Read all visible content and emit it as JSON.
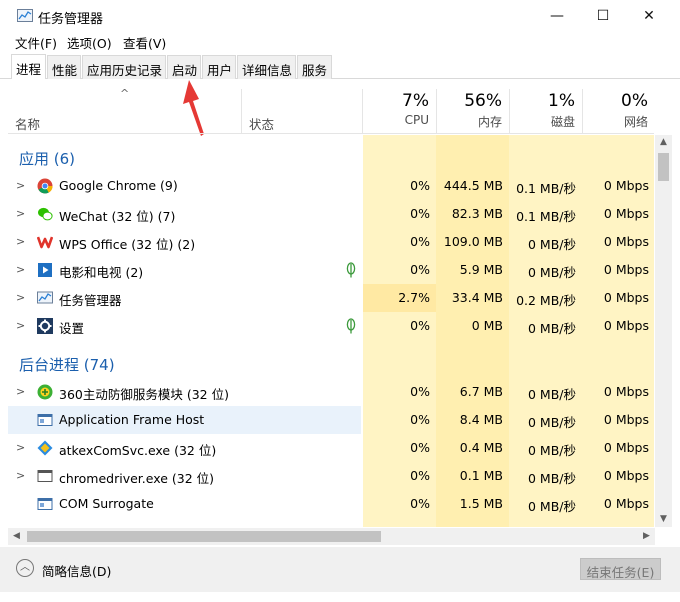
{
  "window": {
    "title": "任务管理器",
    "minimize": "—",
    "maximize": "☐",
    "close": "✕"
  },
  "menu": [
    "文件(F)",
    "选项(O)",
    "查看(V)"
  ],
  "tabs": [
    "进程",
    "性能",
    "应用历史记录",
    "启动",
    "用户",
    "详细信息",
    "服务"
  ],
  "header": {
    "sort_indicator": "^",
    "name": "名称",
    "status": "状态",
    "cpu": {
      "pct": "7%",
      "label": "CPU"
    },
    "memory": {
      "pct": "56%",
      "label": "内存"
    },
    "disk": {
      "pct": "1%",
      "label": "磁盘"
    },
    "network": {
      "pct": "0%",
      "label": "网络"
    }
  },
  "groups": [
    {
      "label": "应用 (6)"
    },
    {
      "label": "后台进程 (74)"
    }
  ],
  "apps": [
    {
      "name": "Google Chrome (9)",
      "icon": "chrome-icon",
      "cpu": "0%",
      "mem": "444.5 MB",
      "disk": "0.1 MB/秒",
      "net": "0 Mbps"
    },
    {
      "name": "WeChat (32 位) (7)",
      "icon": "wechat-icon",
      "cpu": "0%",
      "mem": "82.3 MB",
      "disk": "0.1 MB/秒",
      "net": "0 Mbps"
    },
    {
      "name": "WPS Office (32 位) (2)",
      "icon": "wps-icon",
      "cpu": "0%",
      "mem": "109.0 MB",
      "disk": "0 MB/秒",
      "net": "0 Mbps"
    },
    {
      "name": "电影和电视 (2)",
      "icon": "movies-tv-icon",
      "cpu": "0%",
      "mem": "5.9 MB",
      "disk": "0 MB/秒",
      "net": "0 Mbps"
    },
    {
      "name": "任务管理器",
      "icon": "task-manager-icon",
      "cpu": "2.7%",
      "mem": "33.4 MB",
      "disk": "0.2 MB/秒",
      "net": "0 Mbps"
    },
    {
      "name": "设置",
      "icon": "settings-gear-icon",
      "cpu": "0%",
      "mem": "0 MB",
      "disk": "0 MB/秒",
      "net": "0 Mbps"
    }
  ],
  "background": [
    {
      "name": "360主动防御服务模块 (32 位)",
      "icon": "360-icon",
      "cpu": "0%",
      "mem": "6.7 MB",
      "disk": "0 MB/秒",
      "net": "0 Mbps"
    },
    {
      "name": "Application Frame Host",
      "icon": "app-window-icon",
      "cpu": "0%",
      "mem": "8.4 MB",
      "disk": "0 MB/秒",
      "net": "0 Mbps"
    },
    {
      "name": "atkexComSvc.exe (32 位)",
      "icon": "atkex-icon",
      "cpu": "0%",
      "mem": "0.4 MB",
      "disk": "0 MB/秒",
      "net": "0 Mbps"
    },
    {
      "name": "chromedriver.exe (32 位)",
      "icon": "console-icon",
      "cpu": "0%",
      "mem": "0.1 MB",
      "disk": "0 MB/秒",
      "net": "0 Mbps"
    },
    {
      "name": "COM Surrogate",
      "icon": "app-window-icon",
      "cpu": "0%",
      "mem": "1.5 MB",
      "disk": "0 MB/秒",
      "net": "0 Mbps"
    }
  ],
  "footer": {
    "fewer_details": "简略信息(D)",
    "end_task": "结束任务(E)"
  },
  "colors": {
    "group_label": "#1b5fad",
    "cpu_col_bg": "#fff4c4",
    "mem_col_bg": "#ffefb0",
    "annotation_arrow": "#e53935"
  }
}
